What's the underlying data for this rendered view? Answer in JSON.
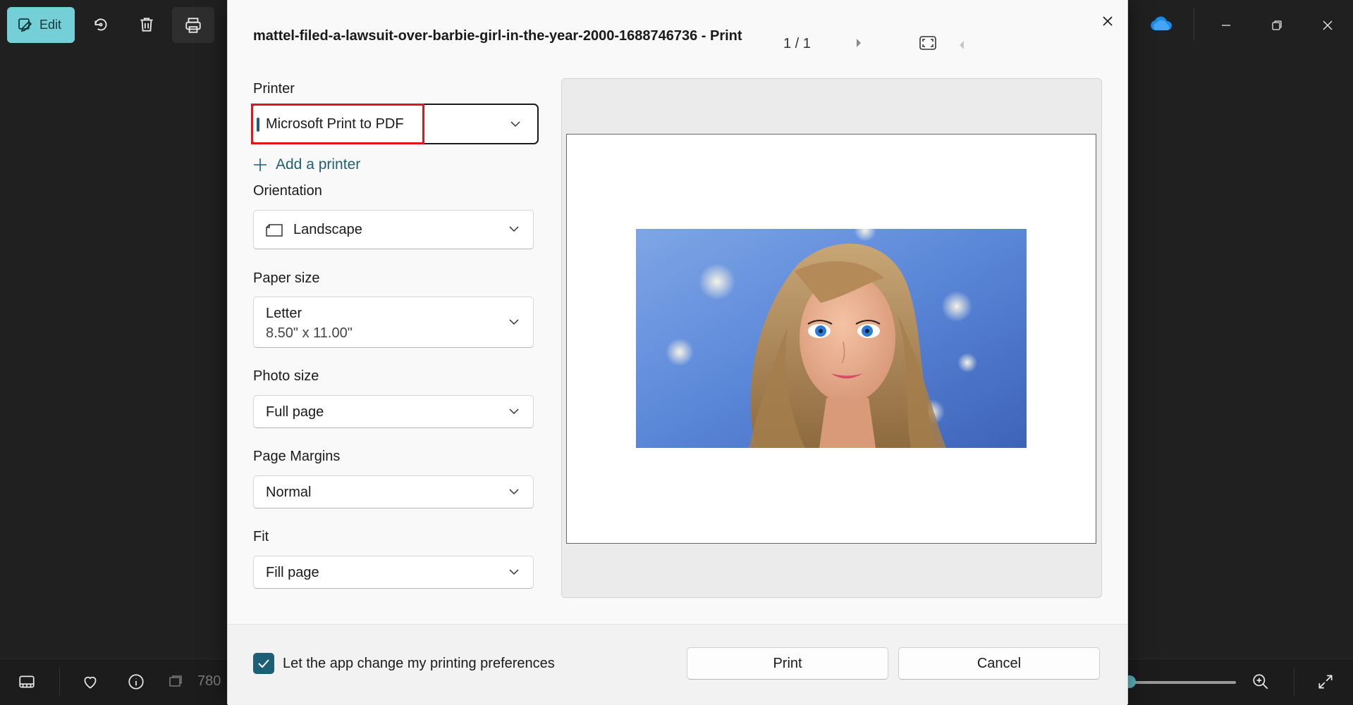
{
  "app": {
    "edit_label": "Edit",
    "image_dimensions_partial": "780",
    "accent_color": "#74cfd7"
  },
  "dialog": {
    "title": "mattel-filed-a-lawsuit-over-barbie-girl-in-the-year-2000-1688746736 - Print",
    "page_indicator": "1 / 1",
    "printer": {
      "label": "Printer",
      "value": "Microsoft Print to PDF",
      "add_printer_label": "Add a printer"
    },
    "orientation": {
      "label": "Orientation",
      "value": "Landscape"
    },
    "paper_size": {
      "label": "Paper size",
      "value": "Letter",
      "detail": "8.50\" x 11.00\""
    },
    "photo_size": {
      "label": "Photo size",
      "value": "Full page"
    },
    "page_margins": {
      "label": "Page Margins",
      "value": "Normal"
    },
    "fit": {
      "label": "Fit",
      "value": "Fill page"
    },
    "preferences_checkbox": {
      "label": "Let the app change my printing preferences",
      "checked": true
    },
    "buttons": {
      "print": "Print",
      "cancel": "Cancel"
    },
    "accent_color": "#1d5f74",
    "highlight_color": "#e0161e"
  }
}
